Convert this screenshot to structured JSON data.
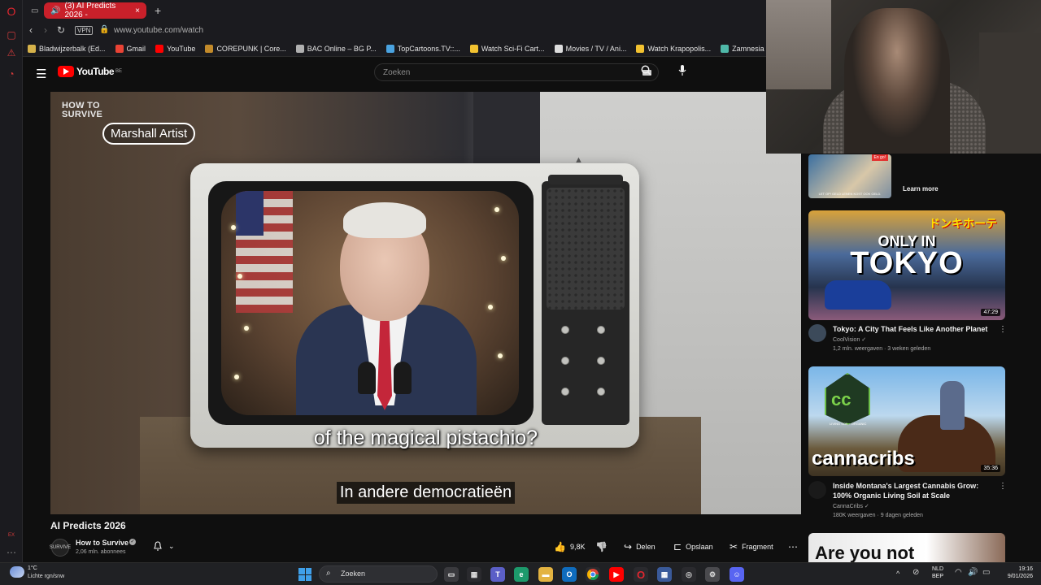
{
  "browser": {
    "active_tab_title": "(3) AI Predicts 2026 -",
    "address": "www.youtube.com/watch",
    "vpn_label": "VPN",
    "bookmarks": [
      {
        "label": "Bladwijzerbalk (Ed...",
        "color": "#d6b24a"
      },
      {
        "label": "Gmail",
        "color": "#ea4335"
      },
      {
        "label": "YouTube",
        "color": "#ff0000"
      },
      {
        "label": "COREPUNK | Core...",
        "color": "#c28a2a"
      },
      {
        "label": "BAC Online – BG P...",
        "color": "#b0b0b0"
      },
      {
        "label": "TopCartoons.TV::...",
        "color": "#4aa3e0"
      },
      {
        "label": "Watch Sci-Fi Cart...",
        "color": "#f2c230"
      },
      {
        "label": "Movies / TV / Ani...",
        "color": "#dddddd"
      },
      {
        "label": "Watch Krapopolis...",
        "color": "#f2c230"
      },
      {
        "label": "Zamnesia | Het Be",
        "color": "#4fb8a8"
      }
    ]
  },
  "youtube": {
    "logo_text": "YouTube",
    "country_code": "BE",
    "search_placeholder": "Zoeken"
  },
  "video": {
    "channel_bug": "HOW TO\nSURVIVE",
    "name_tag": "Marshall Artist",
    "caption_en": "of the magical pistachio?",
    "caption_nl": "In andere democratieën",
    "title": "AI Predicts 2026",
    "channel_name": "How to Survive",
    "subscribers": "2,06 mln. abonnees",
    "channel_avatar_text": "SURVIVE",
    "like_count": "9,8K",
    "actions": {
      "share": "Delen",
      "save": "Opslaan",
      "clip": "Fragment"
    }
  },
  "sidebar": {
    "ad": {
      "badge": "En go!",
      "caption": "LET OP! GELD LENEN KOST OOK GELD.",
      "learn_more": "Learn more"
    },
    "recommendations": [
      {
        "title": "Tokyo: A City That Feels Like Another Planet",
        "channel": "CoolVision",
        "meta": "1,2 mln. weergaven · 3 weken geleden",
        "duration": "47:29",
        "thumb_small": "ONLY IN",
        "thumb_big": "TOKYO",
        "thumb_jp": "ドンキホーテ",
        "avatar_color": "#3c4a5a"
      },
      {
        "title": "Inside Montana's Largest Cannabis Grow: 100% Organic Living Soil at Scale",
        "channel": "CannaCribs",
        "meta": "180K weergaven · 9 dagen geleden",
        "duration": "35:36",
        "thumb_word": "cannacribs",
        "thumb_logo": "cc",
        "thumb_sub": "LIVING SOIL · ORGANIC",
        "avatar_color": "#1a1a1a"
      }
    ],
    "partial_thumb_text": "Are you not"
  },
  "taskbar": {
    "temperature": "1°C",
    "weather": "Lichte rgn/snw",
    "search_label": "Zoeken",
    "language_line1": "NLD",
    "language_line2": "BEP",
    "time": "19:16",
    "date": "9/01/2026"
  }
}
